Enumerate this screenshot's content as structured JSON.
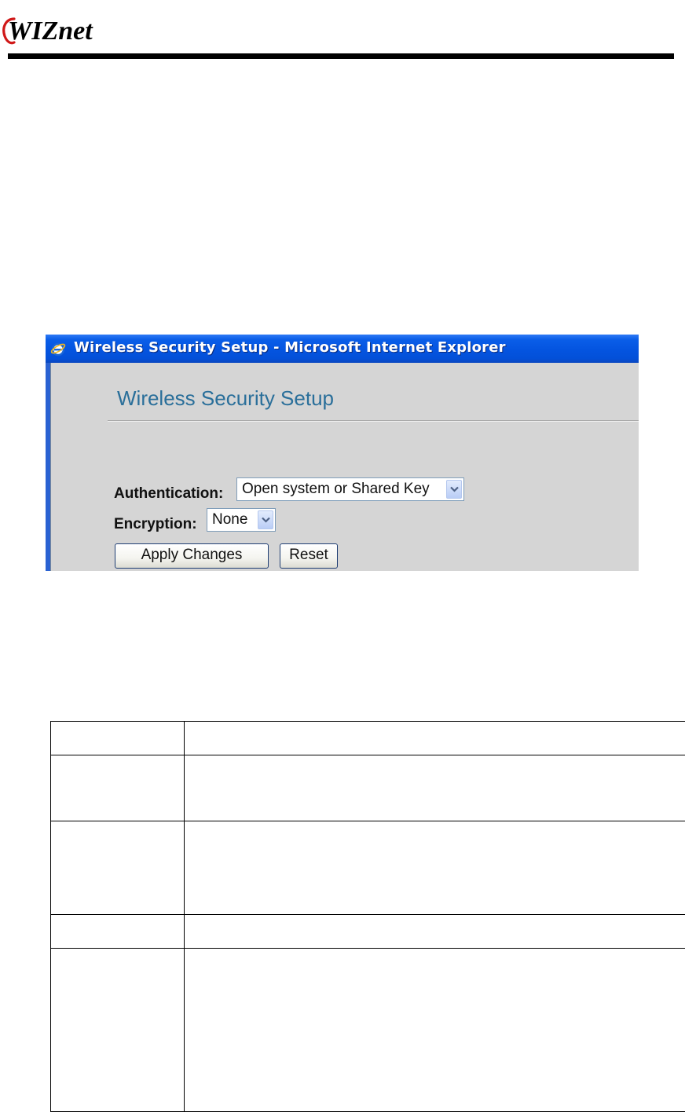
{
  "header": {
    "logo_text": "WIZnet"
  },
  "ie_window": {
    "title": "Wireless Security Setup - Microsoft Internet Explorer",
    "icon": "internet-explorer-icon",
    "page_heading": "Wireless Security Setup",
    "authentication": {
      "label": "Authentication:",
      "selected": "Open system or Shared Key"
    },
    "encryption": {
      "label": "Encryption:",
      "selected": "None"
    },
    "apply_button": "Apply Changes",
    "reset_button": "Reset"
  },
  "table": {
    "rows": [
      {
        "col1": "",
        "col2": ""
      },
      {
        "col1": "",
        "col2": ""
      },
      {
        "col1": "",
        "col2": ""
      },
      {
        "col1": "",
        "col2": ""
      },
      {
        "col1": "",
        "col2": ""
      }
    ]
  },
  "colors": {
    "titlebar": "#0454e0",
    "heading": "#2a6f9a",
    "window_bg": "#d5d5d5"
  }
}
